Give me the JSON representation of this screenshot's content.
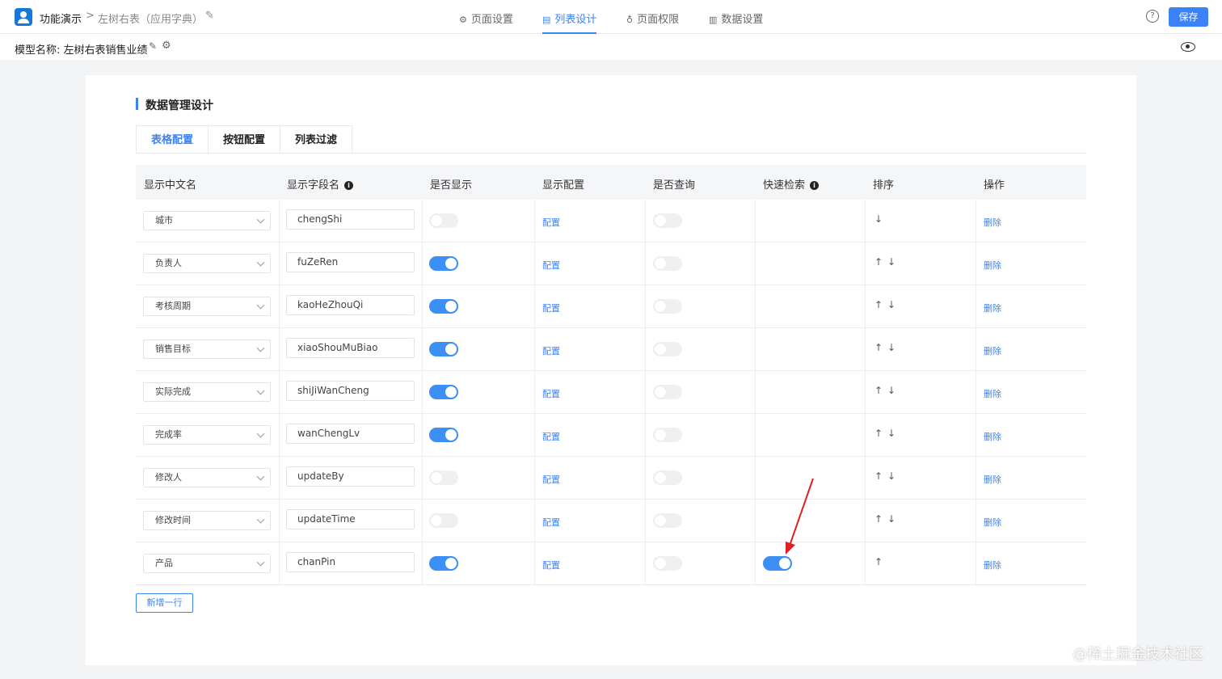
{
  "header": {
    "app_name": "功能演示",
    "separator": ">",
    "page_name": "左树右表（应用字典）",
    "nav_tabs": [
      {
        "label": "页面设置",
        "icon": "gear-icon"
      },
      {
        "label": "列表设计",
        "icon": "list-design-icon"
      },
      {
        "label": "页面权限",
        "icon": "permission-icon"
      },
      {
        "label": "数据设置",
        "icon": "bar-chart-icon"
      }
    ],
    "active_tab": "列表设计",
    "help_label": "?",
    "save_label": "保存"
  },
  "subheader": {
    "model_label": "模型名称:  左树右表销售业绩"
  },
  "section": {
    "title": "数据管理设计",
    "tabs": [
      "表格配置",
      "按钮配置",
      "列表过滤"
    ]
  },
  "table": {
    "columns": [
      "显示中文名",
      "显示字段名",
      "是否显示",
      "显示配置",
      "是否查询",
      "快速检索",
      "排序",
      "操作"
    ],
    "config_label": "配置",
    "delete_label": "删除",
    "rows": [
      {
        "cn": "城市",
        "field": "chengShi",
        "show": false,
        "query": false,
        "quick": null,
        "sort": "↓"
      },
      {
        "cn": "负责人",
        "field": "fuZeRen",
        "show": true,
        "query": false,
        "quick": null,
        "sort": "↑↓"
      },
      {
        "cn": "考核周期",
        "field": "kaoHeZhouQi",
        "show": true,
        "query": false,
        "quick": null,
        "sort": "↑↓"
      },
      {
        "cn": "销售目标",
        "field": "xiaoShouMuBiao",
        "show": true,
        "query": false,
        "quick": null,
        "sort": "↑↓"
      },
      {
        "cn": "实际完成",
        "field": "shiJiWanCheng",
        "show": true,
        "query": false,
        "quick": null,
        "sort": "↑↓"
      },
      {
        "cn": "完成率",
        "field": "wanChengLv",
        "show": true,
        "query": false,
        "quick": null,
        "sort": "↑↓"
      },
      {
        "cn": "修改人",
        "field": "updateBy",
        "show": false,
        "query": false,
        "quick": null,
        "sort": "↑↓"
      },
      {
        "cn": "修改时间",
        "field": "updateTime",
        "show": false,
        "query": false,
        "quick": null,
        "sort": "↑↓"
      },
      {
        "cn": "产品",
        "field": "chanPin",
        "show": true,
        "query": false,
        "quick": true,
        "sort": "↑"
      }
    ]
  },
  "add_row_label": "新增一行",
  "watermark": "@稀土掘金技术社区",
  "colors": {
    "accent": "#3b82f6",
    "annotation": "#e02020"
  }
}
